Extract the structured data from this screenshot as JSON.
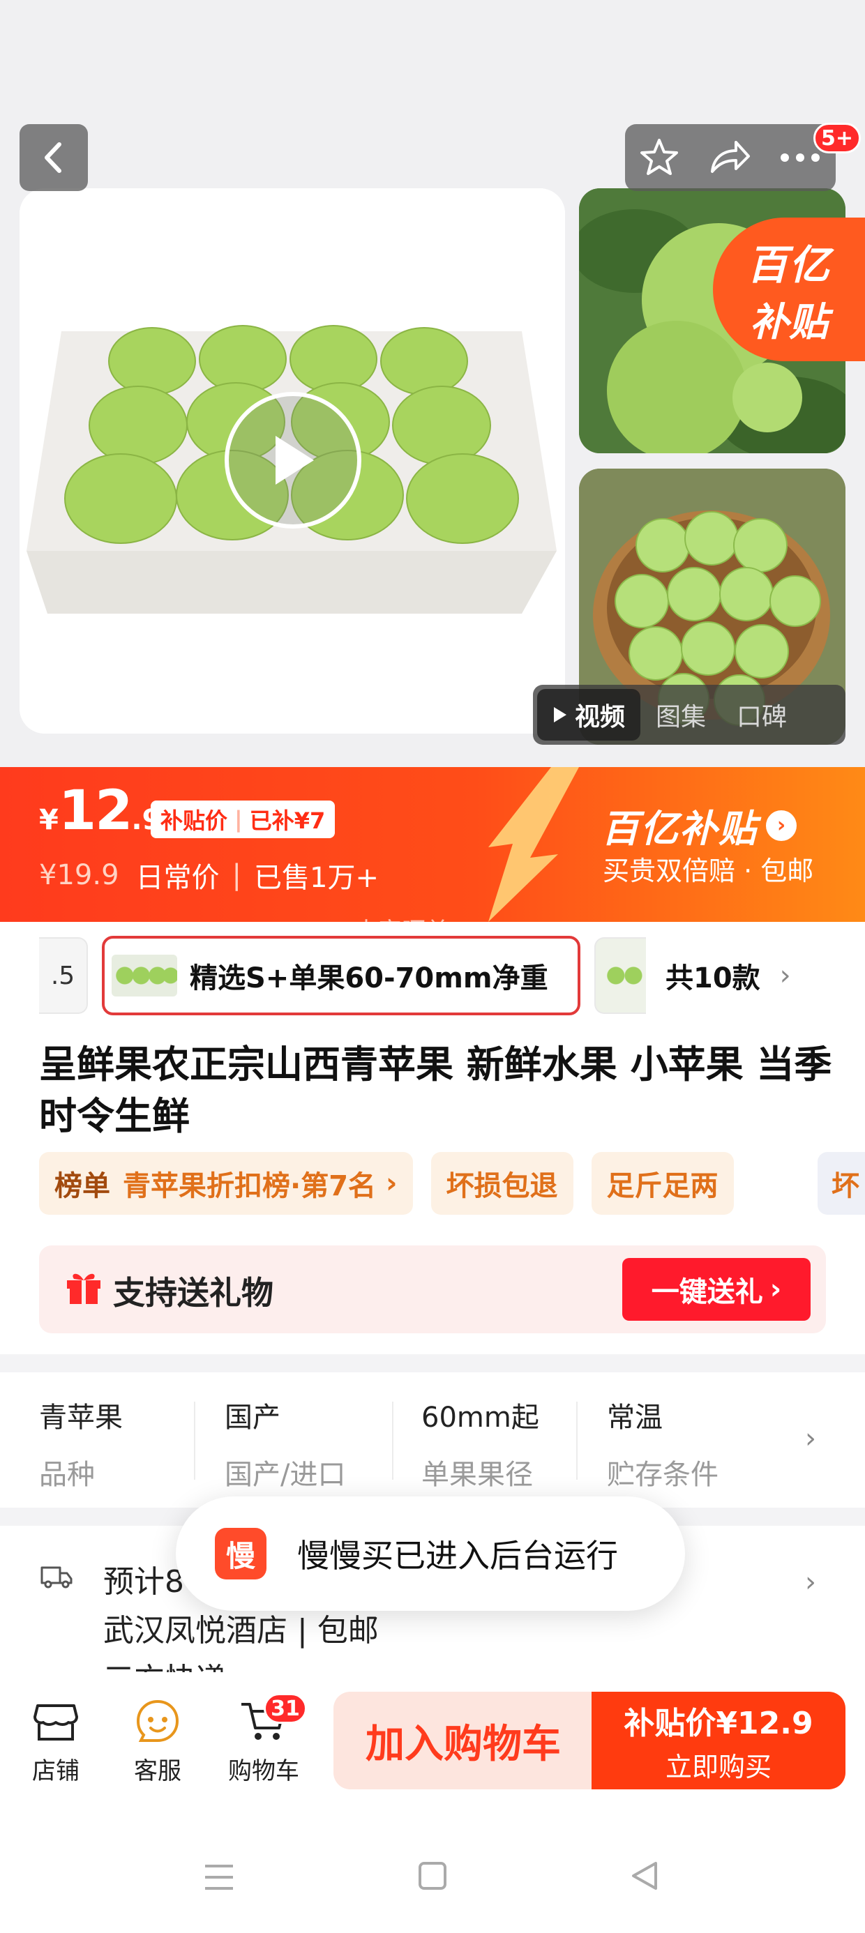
{
  "header": {
    "notification_badge": "5+"
  },
  "gallery": {
    "yi_badge_line1": "百亿",
    "yi_badge_line2": "补贴",
    "media_tabs": [
      "视频",
      "图集",
      "口碑"
    ],
    "active_media_tab": "视频"
  },
  "price": {
    "currency": "¥",
    "integer": "12",
    "decimal": ".9",
    "subsidy_label": "补贴价",
    "subsidy_amount": "已补¥7",
    "original_price": "¥19.9",
    "original_label": "日常价",
    "sold": "已售1万+",
    "yi_title": "百亿补贴",
    "yi_subtitle": "买贵双倍赔 · 包邮",
    "watermark": "大家晒单"
  },
  "variants": {
    "partial_label": ".5",
    "selected_label": "精选S+单果60-70mm净重",
    "count_label": "共10款"
  },
  "product": {
    "title": "呈鲜果农正宗山西青苹果 新鲜水果 小苹果 当季时令生鲜"
  },
  "tags": {
    "rank_key": "榜单",
    "rank_value": "青苹果折扣榜·第7名",
    "tag2": "坏损包退",
    "tag3": "足斤足两",
    "tag4_cut": "坏"
  },
  "gift": {
    "text": "支持送礼物",
    "button": "一键送礼"
  },
  "specs": [
    {
      "value": "青苹果",
      "label": "品种"
    },
    {
      "value": "国产",
      "label": "国产/进口"
    },
    {
      "value": "60mm起",
      "label": "单果果径"
    },
    {
      "value": "常温",
      "label": "贮存条件"
    }
  ],
  "delivery": {
    "line1": "预计8",
    "line2": "武汉凤悦酒店 | 包邮",
    "line3": "三方快递"
  },
  "toast": {
    "logo": "慢",
    "text": "慢慢买已进入后台运行"
  },
  "bottom_bar": {
    "store": "店铺",
    "service": "客服",
    "cart": "购物车",
    "cart_badge": "31",
    "add_to_cart": "加入购物车",
    "buy_price_label": "补贴价¥12.9",
    "buy_now": "立即购买"
  },
  "colors": {
    "accent": "#ff3b1d",
    "subsidy_orange": "#ff5a1f",
    "tag_text": "#e0701a",
    "gift_button": "#ff1a2c"
  }
}
